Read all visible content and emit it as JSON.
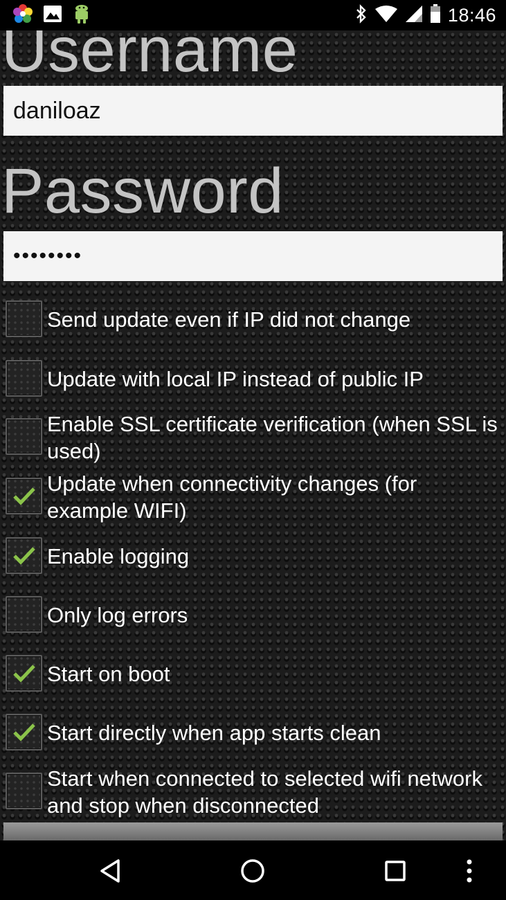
{
  "status_bar": {
    "time": "18:46",
    "left_icons": [
      "pinwheel-app-icon",
      "image-icon",
      "android-robot-icon"
    ],
    "right_icons": [
      "bluetooth-icon",
      "wifi-icon",
      "cellular-signal-icon",
      "battery-icon"
    ]
  },
  "form": {
    "username_label": "Username",
    "username_value": "daniloaz",
    "password_label": "Password",
    "password_value": "••••••••"
  },
  "options": [
    {
      "label": "Send update even if IP did not change",
      "checked": false
    },
    {
      "label": "Update with local IP instead of public IP",
      "checked": false
    },
    {
      "label": "Enable SSL certificate verification (when SSL is used)",
      "checked": false
    },
    {
      "label": "Update when connectivity changes (for example WIFI)",
      "checked": true
    },
    {
      "label": "Enable logging",
      "checked": true
    },
    {
      "label": "Only log errors",
      "checked": false
    },
    {
      "label": "Start on boot",
      "checked": true
    },
    {
      "label": "Start directly when app starts clean",
      "checked": true
    },
    {
      "label": "Start when connected to selected wifi network and stop when disconnected",
      "checked": false
    }
  ],
  "colors": {
    "check_mark": "#8bc34a",
    "label_gray": "#c4c4c4",
    "field_bg": "#f4f4f4"
  },
  "nav_bar": {
    "buttons": [
      "back-icon",
      "home-icon",
      "recents-icon",
      "overflow-menu-icon"
    ]
  }
}
